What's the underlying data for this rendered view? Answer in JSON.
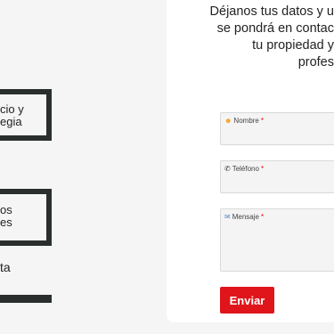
{
  "left": {
    "card1_line1": "cio y",
    "card1_line2": "egia",
    "card2_line1": "os",
    "card2_line2": "es",
    "plain_text": "ta"
  },
  "form": {
    "intro_lines": [
      "Déjanos tus datos y u",
      "se pondrá en contac",
      "tu propiedad y",
      "profes"
    ],
    "fields": {
      "name": {
        "label": "Nombre",
        "required_mark": "*",
        "icon": "smile-icon"
      },
      "phone": {
        "label": "Teléfono",
        "required_mark": "*",
        "icon": "phone-icon"
      },
      "message": {
        "label": "Mensaje",
        "required_mark": "*",
        "icon": "envelope-icon"
      }
    },
    "submit_label": "Enviar"
  },
  "colors": {
    "accent": "#e0151c",
    "dark_border": "#2a2f2e",
    "background": "#f5f5f5",
    "panel": "#ffffff"
  }
}
